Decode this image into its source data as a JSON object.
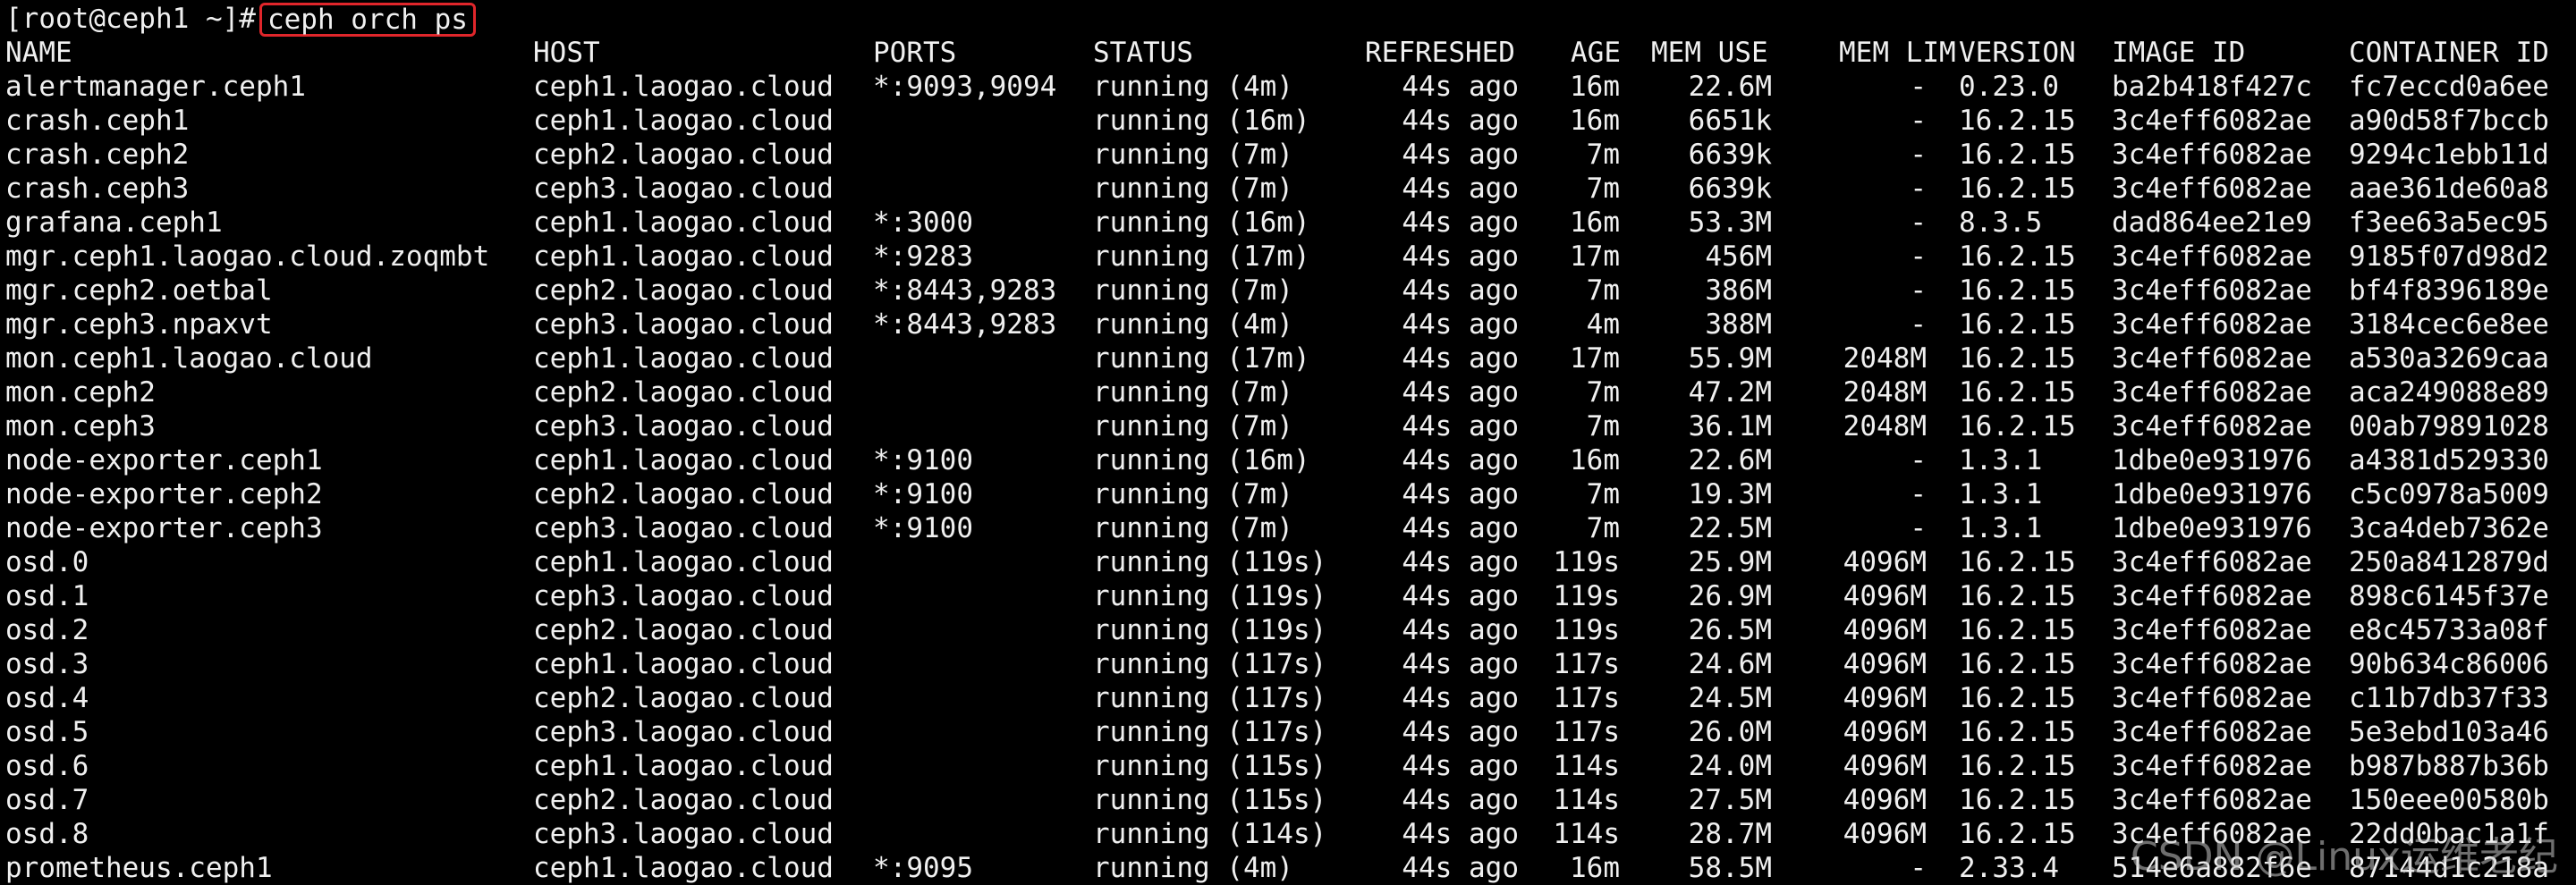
{
  "colors": {
    "background": "#000000",
    "text": "#f0f0f0",
    "highlight_border": "#e0262b"
  },
  "prompt": {
    "text": "[root@ceph1 ~]#",
    "command": "ceph orch ps"
  },
  "columns": [
    "NAME",
    "HOST",
    "PORTS",
    "STATUS",
    "REFRESHED",
    "AGE",
    "MEM USE",
    "MEM LIM",
    "VERSION",
    "IMAGE ID",
    "CONTAINER ID"
  ],
  "rows": [
    [
      "alertmanager.ceph1",
      "ceph1.laogao.cloud",
      "*:9093,9094",
      "running (4m)",
      "44s ago",
      "16m",
      "22.6M",
      "-",
      "0.23.0",
      "ba2b418f427c",
      "fc7eccd0a6ee"
    ],
    [
      "crash.ceph1",
      "ceph1.laogao.cloud",
      "",
      "running (16m)",
      "44s ago",
      "16m",
      "6651k",
      "-",
      "16.2.15",
      "3c4eff6082ae",
      "a90d58f7bccb"
    ],
    [
      "crash.ceph2",
      "ceph2.laogao.cloud",
      "",
      "running (7m)",
      "44s ago",
      "7m",
      "6639k",
      "-",
      "16.2.15",
      "3c4eff6082ae",
      "9294c1ebb11d"
    ],
    [
      "crash.ceph3",
      "ceph3.laogao.cloud",
      "",
      "running (7m)",
      "44s ago",
      "7m",
      "6639k",
      "-",
      "16.2.15",
      "3c4eff6082ae",
      "aae361de60a8"
    ],
    [
      "grafana.ceph1",
      "ceph1.laogao.cloud",
      "*:3000",
      "running (16m)",
      "44s ago",
      "16m",
      "53.3M",
      "-",
      "8.3.5",
      "dad864ee21e9",
      "f3ee63a5ec95"
    ],
    [
      "mgr.ceph1.laogao.cloud.zoqmbt",
      "ceph1.laogao.cloud",
      "*:9283",
      "running (17m)",
      "44s ago",
      "17m",
      "456M",
      "-",
      "16.2.15",
      "3c4eff6082ae",
      "9185f07d98d2"
    ],
    [
      "mgr.ceph2.oetbal",
      "ceph2.laogao.cloud",
      "*:8443,9283",
      "running (7m)",
      "44s ago",
      "7m",
      "386M",
      "-",
      "16.2.15",
      "3c4eff6082ae",
      "bf4f8396189e"
    ],
    [
      "mgr.ceph3.npaxvt",
      "ceph3.laogao.cloud",
      "*:8443,9283",
      "running (4m)",
      "44s ago",
      "4m",
      "388M",
      "-",
      "16.2.15",
      "3c4eff6082ae",
      "3184cec6e8ee"
    ],
    [
      "mon.ceph1.laogao.cloud",
      "ceph1.laogao.cloud",
      "",
      "running (17m)",
      "44s ago",
      "17m",
      "55.9M",
      "2048M",
      "16.2.15",
      "3c4eff6082ae",
      "a530a3269caa"
    ],
    [
      "mon.ceph2",
      "ceph2.laogao.cloud",
      "",
      "running (7m)",
      "44s ago",
      "7m",
      "47.2M",
      "2048M",
      "16.2.15",
      "3c4eff6082ae",
      "aca249088e89"
    ],
    [
      "mon.ceph3",
      "ceph3.laogao.cloud",
      "",
      "running (7m)",
      "44s ago",
      "7m",
      "36.1M",
      "2048M",
      "16.2.15",
      "3c4eff6082ae",
      "00ab79891028"
    ],
    [
      "node-exporter.ceph1",
      "ceph1.laogao.cloud",
      "*:9100",
      "running (16m)",
      "44s ago",
      "16m",
      "22.6M",
      "-",
      "1.3.1",
      "1dbe0e931976",
      "a4381d529330"
    ],
    [
      "node-exporter.ceph2",
      "ceph2.laogao.cloud",
      "*:9100",
      "running (7m)",
      "44s ago",
      "7m",
      "19.3M",
      "-",
      "1.3.1",
      "1dbe0e931976",
      "c5c0978a5009"
    ],
    [
      "node-exporter.ceph3",
      "ceph3.laogao.cloud",
      "*:9100",
      "running (7m)",
      "44s ago",
      "7m",
      "22.5M",
      "-",
      "1.3.1",
      "1dbe0e931976",
      "3ca4deb7362e"
    ],
    [
      "osd.0",
      "ceph1.laogao.cloud",
      "",
      "running (119s)",
      "44s ago",
      "119s",
      "25.9M",
      "4096M",
      "16.2.15",
      "3c4eff6082ae",
      "250a8412879d"
    ],
    [
      "osd.1",
      "ceph3.laogao.cloud",
      "",
      "running (119s)",
      "44s ago",
      "119s",
      "26.9M",
      "4096M",
      "16.2.15",
      "3c4eff6082ae",
      "898c6145f37e"
    ],
    [
      "osd.2",
      "ceph2.laogao.cloud",
      "",
      "running (119s)",
      "44s ago",
      "119s",
      "26.5M",
      "4096M",
      "16.2.15",
      "3c4eff6082ae",
      "e8c45733a08f"
    ],
    [
      "osd.3",
      "ceph1.laogao.cloud",
      "",
      "running (117s)",
      "44s ago",
      "117s",
      "24.6M",
      "4096M",
      "16.2.15",
      "3c4eff6082ae",
      "90b634c86006"
    ],
    [
      "osd.4",
      "ceph2.laogao.cloud",
      "",
      "running (117s)",
      "44s ago",
      "117s",
      "24.5M",
      "4096M",
      "16.2.15",
      "3c4eff6082ae",
      "c11b7db37f33"
    ],
    [
      "osd.5",
      "ceph3.laogao.cloud",
      "",
      "running (117s)",
      "44s ago",
      "117s",
      "26.0M",
      "4096M",
      "16.2.15",
      "3c4eff6082ae",
      "5e3ebd103a46"
    ],
    [
      "osd.6",
      "ceph1.laogao.cloud",
      "",
      "running (115s)",
      "44s ago",
      "114s",
      "24.0M",
      "4096M",
      "16.2.15",
      "3c4eff6082ae",
      "b987b887b36b"
    ],
    [
      "osd.7",
      "ceph2.laogao.cloud",
      "",
      "running (115s)",
      "44s ago",
      "114s",
      "27.5M",
      "4096M",
      "16.2.15",
      "3c4eff6082ae",
      "150eee00580b"
    ],
    [
      "osd.8",
      "ceph3.laogao.cloud",
      "",
      "running (114s)",
      "44s ago",
      "114s",
      "28.7M",
      "4096M",
      "16.2.15",
      "3c4eff6082ae",
      "22dd0bac1a1f"
    ],
    [
      "prometheus.ceph1",
      "ceph1.laogao.cloud",
      "*:9095",
      "running (4m)",
      "44s ago",
      "16m",
      "58.5M",
      "-",
      "2.33.4",
      "514e6a882f6e",
      "87144d1c218a"
    ]
  ],
  "watermark": "CSDN @Linux运维老纪"
}
